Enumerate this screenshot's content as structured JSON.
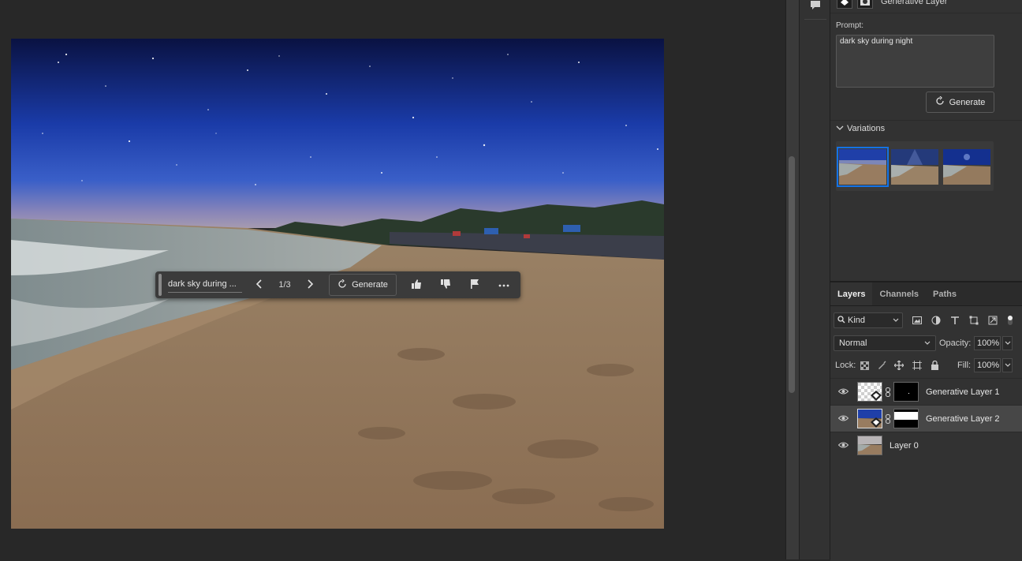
{
  "canvas": {
    "image": "beach-night-sky"
  },
  "context_taskbar": {
    "prompt_text": "dark sky during ...",
    "counter": "1/3",
    "generate_label": "Generate",
    "icons": [
      "previous-icon",
      "next-icon",
      "generate-icon",
      "thumbs-up-icon",
      "thumbs-down-icon",
      "flag-icon",
      "more-icon"
    ]
  },
  "properties": {
    "title": "Generative Layer",
    "prompt_label": "Prompt:",
    "prompt_value": "dark sky during night",
    "generate_label": "Generate",
    "variations_label": "Variations",
    "variations_count": 3,
    "selected_variation": 1
  },
  "layers_panel": {
    "tabs": [
      "Layers",
      "Channels",
      "Paths"
    ],
    "active_tab": "Layers",
    "kind_label": "Kind",
    "blend_mode": "Normal",
    "opacity_label": "Opacity:",
    "opacity_value": "100%",
    "lock_label": "Lock:",
    "fill_label": "Fill:",
    "fill_value": "100%",
    "layers": [
      {
        "name": "Generative Layer 1",
        "visible": true,
        "selected": false
      },
      {
        "name": "Generative Layer 2",
        "visible": true,
        "selected": true
      },
      {
        "name": "Layer 0",
        "visible": true,
        "selected": false
      }
    ]
  },
  "colors": {
    "accent": "#1473e6",
    "panel": "#323232",
    "workspace": "#282828"
  }
}
